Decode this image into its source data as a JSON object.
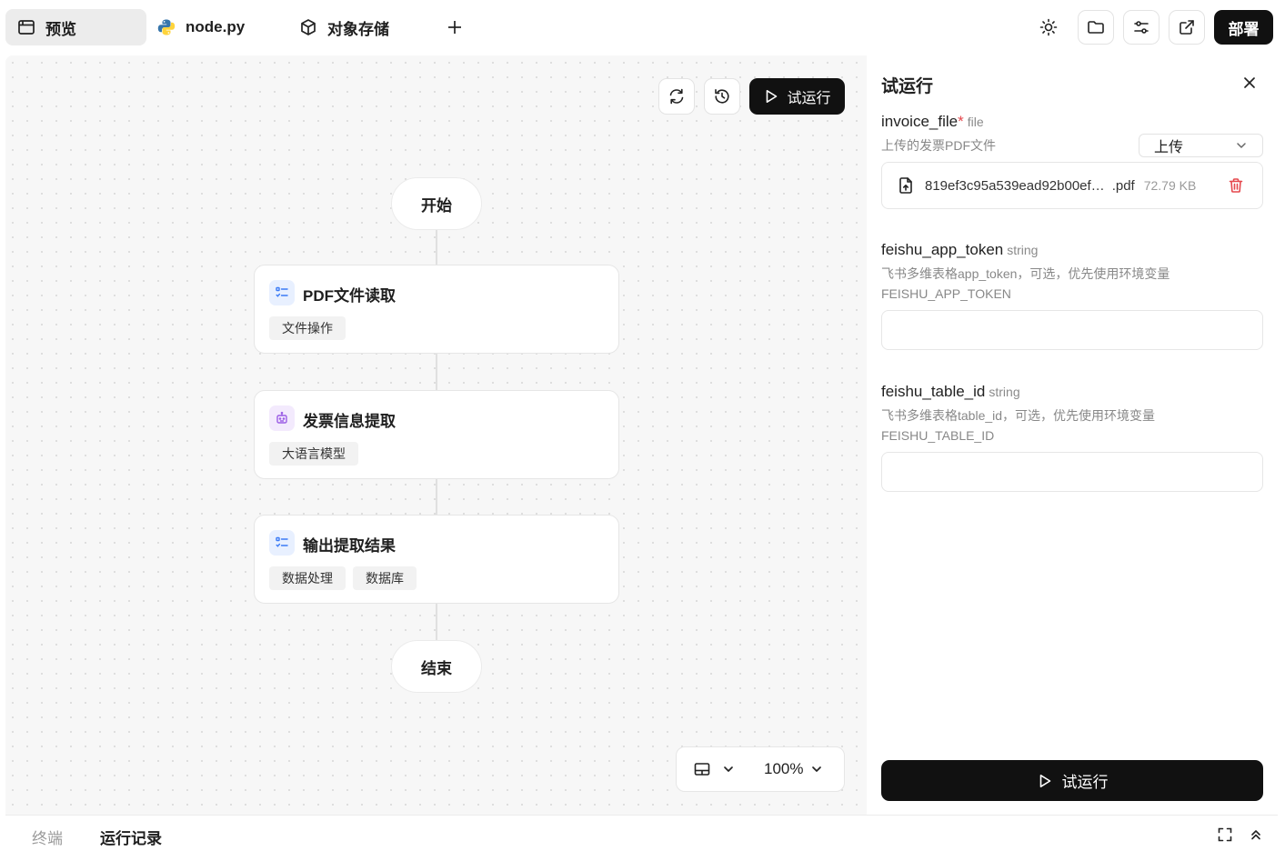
{
  "tabs": [
    {
      "label": "预览",
      "icon": "window-icon",
      "active": true
    },
    {
      "label": "node.py",
      "icon": "python-icon",
      "active": false
    },
    {
      "label": "对象存储",
      "icon": "cube-icon",
      "active": false
    }
  ],
  "toolbar": {
    "deploy_label": "部署",
    "icons": [
      "sun-icon",
      "folder-icon",
      "sliders-icon",
      "external-link-icon"
    ]
  },
  "canvas": {
    "run_label": "试运行",
    "start_label": "开始",
    "end_label": "结束",
    "nodes": [
      {
        "title": "PDF文件读取",
        "icon": "list-icon",
        "tags": [
          "文件操作"
        ]
      },
      {
        "title": "发票信息提取",
        "icon": "robot-icon",
        "tags": [
          "大语言模型"
        ]
      },
      {
        "title": "输出提取结果",
        "icon": "list-icon",
        "tags": [
          "数据处理",
          "数据库"
        ]
      }
    ],
    "zoom": "100%"
  },
  "panel": {
    "title": "试运行",
    "fields": [
      {
        "name": "invoice_file",
        "required": "*",
        "type": "file",
        "desc": "上传的发票PDF文件"
      },
      {
        "name": "feishu_app_token",
        "type": "string",
        "desc": "飞书多维表格app_token，可选，优先使用环境变量FEISHU_APP_TOKEN",
        "value": ""
      },
      {
        "name": "feishu_table_id",
        "type": "string",
        "desc": "飞书多维表格table_id，可选，优先使用环境变量FEISHU_TABLE_ID",
        "value": ""
      }
    ],
    "upload_select": "上传",
    "file": {
      "name": "819ef3c95a539ead92b00ef…",
      "ext": ".pdf",
      "size": "72.79 KB"
    },
    "run_label": "试运行"
  },
  "bottom": {
    "tabs": [
      {
        "label": "终端",
        "active": false
      },
      {
        "label": "运行记录",
        "active": true
      }
    ]
  },
  "colors": {
    "accent": "#111111",
    "danger": "#e5484d",
    "node_icon_blue": "#3b7bf6",
    "node_icon_purple": "#9b5de5"
  }
}
